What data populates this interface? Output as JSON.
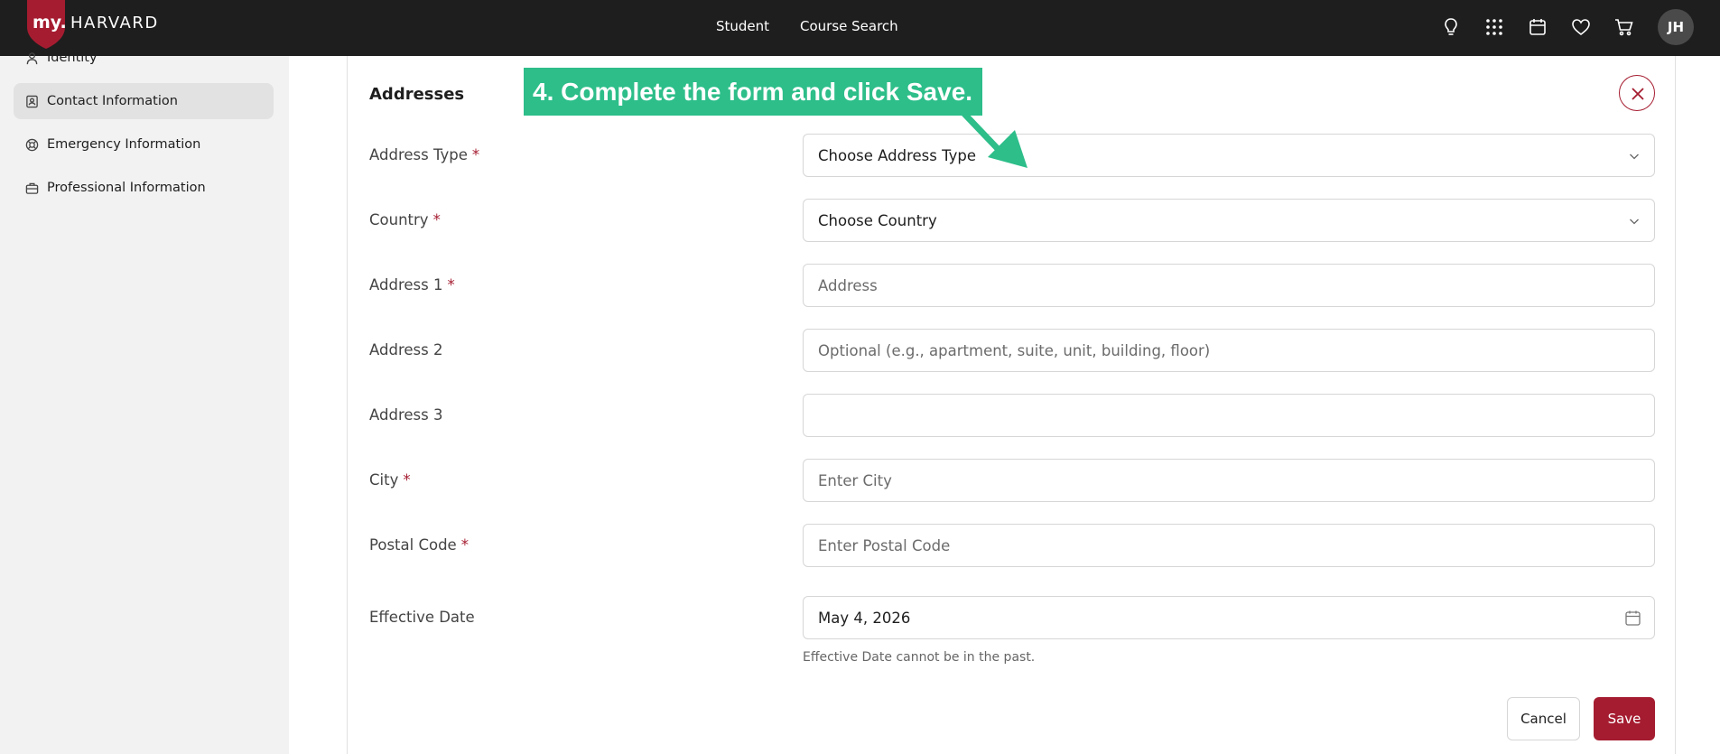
{
  "header": {
    "logo_my": "my.",
    "logo_word": "HARVARD",
    "nav": [
      "Student",
      "Course Search"
    ],
    "icons": [
      "lightbulb-icon",
      "apps-grid-icon",
      "calendar-icon",
      "heart-icon",
      "cart-icon"
    ],
    "avatar_initials": "JH"
  },
  "sidebar": {
    "items": [
      {
        "label": "Identity",
        "icon": "person-icon",
        "active": false
      },
      {
        "label": "Contact Information",
        "icon": "contact-card-icon",
        "active": true
      },
      {
        "label": "Emergency Information",
        "icon": "lifebuoy-icon",
        "active": false
      },
      {
        "label": "Professional Information",
        "icon": "briefcase-icon",
        "active": false
      }
    ]
  },
  "form": {
    "title": "Addresses",
    "required_mark": "*",
    "fields": {
      "address_type": {
        "label": "Address Type",
        "value": "Choose Address Type"
      },
      "country": {
        "label": "Country",
        "value": "Choose Country"
      },
      "address1": {
        "label": "Address 1",
        "placeholder": "Address"
      },
      "address2": {
        "label": "Address 2",
        "placeholder": "Optional (e.g., apartment, suite, unit, building, floor)"
      },
      "address3": {
        "label": "Address 3",
        "placeholder": ""
      },
      "city": {
        "label": "City",
        "placeholder": "Enter City"
      },
      "postal": {
        "label": "Postal Code",
        "placeholder": "Enter Postal Code"
      },
      "effective_date": {
        "label": "Effective Date",
        "value": "May 4, 2026",
        "helper": "Effective Date cannot be in the past."
      }
    },
    "cancel_label": "Cancel",
    "save_label": "Save"
  },
  "callout": {
    "text": "4. Complete the form and click Save."
  },
  "colors": {
    "brand": "#a51c30",
    "topbar": "#1e1e1e",
    "callout": "#2dbe8a"
  }
}
